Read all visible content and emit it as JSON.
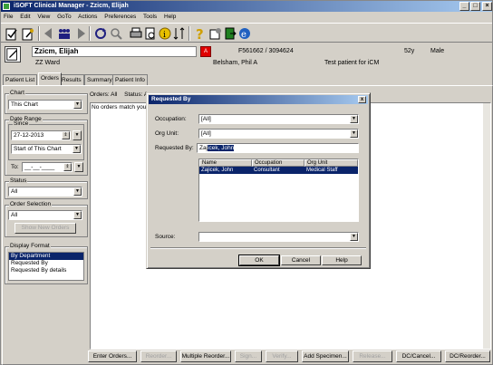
{
  "window": {
    "title": "iSOFT Clinical Manager - Zzicm, Elijah"
  },
  "menu": [
    "File",
    "Edit",
    "View",
    "GoTo",
    "Actions",
    "Preferences",
    "Tools",
    "Help"
  ],
  "patient": {
    "name": "Zzicm, Elijah",
    "alert": "A",
    "ids": "F561662 / 3094624",
    "age": "52y",
    "sex": "Male",
    "ward": "ZZ Ward",
    "doctor": "Belsham, Phil A",
    "note": "Test patient for iCM"
  },
  "tabs": [
    "Patient List",
    "Orders",
    "Results",
    "Summary",
    "Patient Info"
  ],
  "left": {
    "chart_label": "Chart",
    "chart_value": "This Chart",
    "date_range_label": "Date Range",
    "since_label": "Since",
    "since_value": "27-12-2013",
    "since_mode": "Start of This Chart",
    "to_label": "To:",
    "to_value": "__-__-____",
    "status_label": "Status",
    "status_value": "All",
    "order_sel_label": "Order Selection",
    "order_sel_value": "All",
    "show_new_orders": "Show New Orders",
    "display_format_label": "Display Format",
    "display_formats": [
      "By Department",
      "Requested By",
      "Requested By details"
    ]
  },
  "orders": {
    "header_orders": "Orders: All",
    "header_status": "Status: A",
    "empty_msg": "No orders match your r"
  },
  "bottom_buttons": [
    "Enter Orders...",
    "Reorder...",
    "Multiple Reorder...",
    "Sign...",
    "Verify...",
    "Add Specimen...",
    "Release...",
    "DC/Cancel...",
    "DC/Reorder..."
  ],
  "dialog": {
    "title": "Requested By",
    "close": "x",
    "occupation_label": "Occupation:",
    "occupation_value": "[All]",
    "org_unit_label": "Org Unit:",
    "org_unit_value": "[All]",
    "requested_by_label": "Requested By:",
    "requested_by_typed": "Zaj",
    "requested_by_selected": "icek, John",
    "columns": [
      "Name",
      "Occupation",
      "Org Unit"
    ],
    "rows": [
      {
        "name": "Zajicek, John",
        "occupation": "Consultant",
        "org_unit": "Medical Staff"
      }
    ],
    "source_label": "Source:",
    "source_value": "",
    "ok": "OK",
    "cancel": "Cancel",
    "help": "Help"
  },
  "colors": {
    "titlebar": "#0a246a",
    "selection": "#0a246a",
    "alert": "#e00000",
    "face": "#d4d0c8"
  }
}
